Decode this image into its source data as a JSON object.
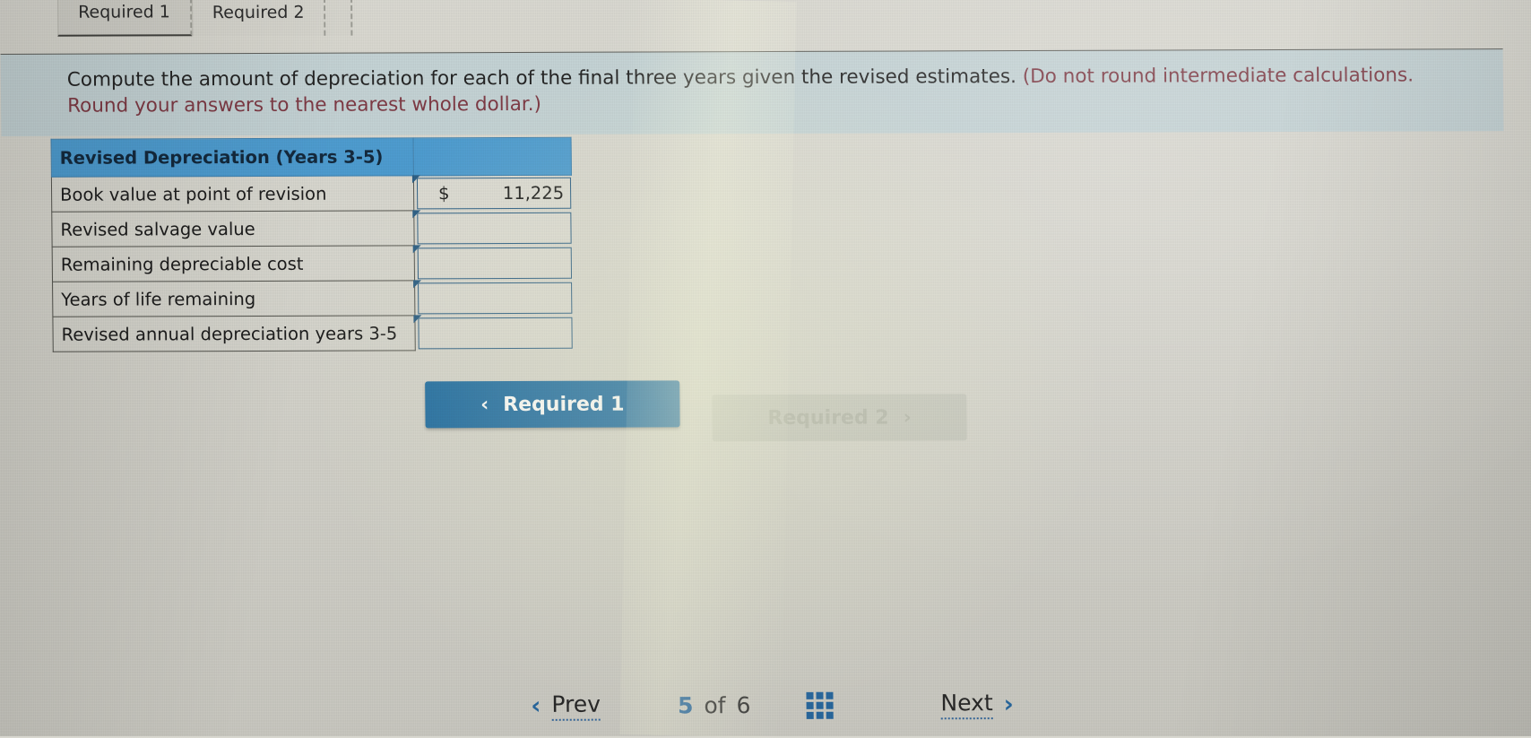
{
  "tabs": [
    {
      "label": "Required 1",
      "active": true
    },
    {
      "label": "Required 2",
      "active": false
    }
  ],
  "instruction": {
    "text_main": "Compute the amount of depreciation for each of the final three years given the revised estimates. ",
    "text_paren": "(Do not round intermediate calculations. Round your answers to the nearest whole dollar.)"
  },
  "table": {
    "header_label": "Revised Depreciation (Years 3-5)",
    "header_value": "",
    "rows": [
      {
        "label": "Book value at point of revision",
        "currency": "$",
        "value": "11,225"
      },
      {
        "label": "Revised salvage value",
        "currency": "",
        "value": ""
      },
      {
        "label": "Remaining depreciable cost",
        "currency": "",
        "value": ""
      },
      {
        "label": "Years of life remaining",
        "currency": "",
        "value": ""
      },
      {
        "label": "Revised annual depreciation years 3-5",
        "currency": "",
        "value": ""
      }
    ]
  },
  "required_nav": {
    "prev_label": "Required 1",
    "prev_chevron": "‹",
    "next_label": "Required 2",
    "next_chevron": "›"
  },
  "pager": {
    "prev_chevron": "‹",
    "prev_label": "Prev",
    "current_page": "5",
    "of_label": "of",
    "total_pages": "6",
    "grid_icon": "grid-icon",
    "next_label": "Next",
    "next_chevron": "›"
  },
  "colors": {
    "table_header_blue": "#4b9bd0",
    "primary_button_blue": "#1f6ea5",
    "instruction_band": "#c3d2d4",
    "paren_text_red": "#7b3540",
    "link_blue": "#2b6ea8",
    "page_background": "#d8d7cf"
  }
}
